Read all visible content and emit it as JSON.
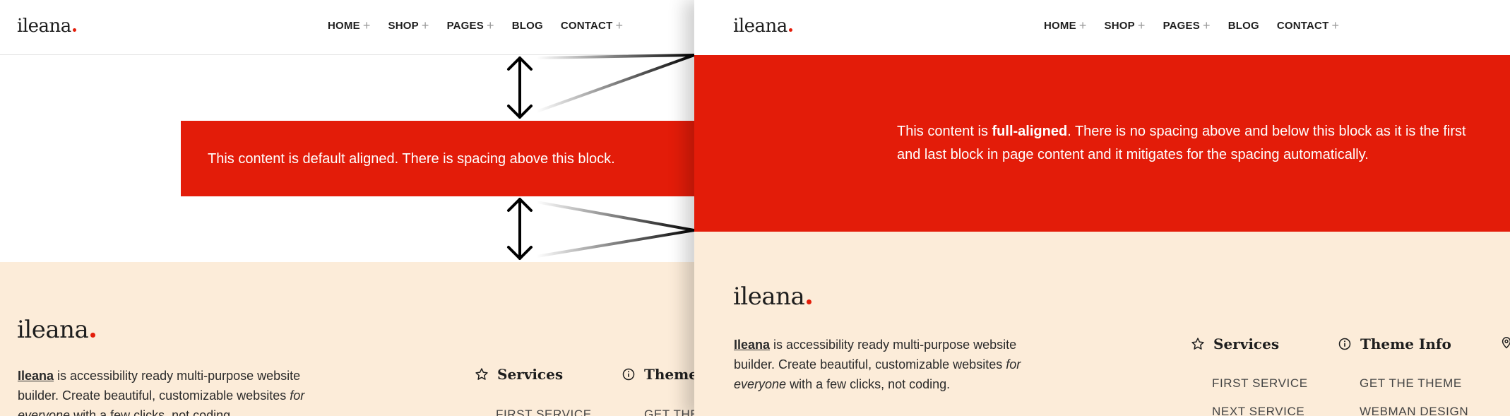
{
  "brand": {
    "name": "ileana",
    "accent_color": "#e31c09",
    "footer_bg": "#fcecd9"
  },
  "nav": [
    {
      "label": "HOME",
      "icon": "plus-icon",
      "has_submenu": true
    },
    {
      "label": "SHOP",
      "icon": "plus-icon",
      "has_submenu": true
    },
    {
      "label": "PAGES",
      "icon": "plus-icon",
      "has_submenu": true
    },
    {
      "label": "BLOG",
      "has_submenu": false
    },
    {
      "label": "CONTACT",
      "icon": "plus-icon",
      "has_submenu": true
    }
  ],
  "left": {
    "block_text": "This content is default aligned. There is spacing above this block."
  },
  "right": {
    "block_prefix": "This content is ",
    "block_bold": "full-aligned",
    "block_rest": ". There is no spacing above and below this block as it is the first and last block in page content and it mitigates for the spacing automatically."
  },
  "footer": {
    "desc_link": "Ileana",
    "desc_main": " is accessibility ready multi-purpose website builder. Create beautiful, customizable websites ",
    "desc_italic": "for everyone",
    "desc_tail": " with a few clicks, not coding.",
    "left_desc_line1_rest": " is accessibility ready multi-purpose website",
    "left_desc_line2": "builder. Create beautiful, customizable websites ",
    "left_desc_line2_italic": "for",
    "left_desc_line3_italic": "everyone",
    "left_desc_line3_rest": " with a few clicks, not coding.",
    "columns": [
      {
        "title": "Services",
        "icon": "star-icon",
        "links": [
          "FIRST SERVICE",
          "NEXT SERVICE"
        ]
      },
      {
        "title": "Theme Info",
        "icon": "info-icon",
        "links": [
          "GET THE THEME",
          "WEBMAN DESIGN"
        ]
      },
      {
        "title": "",
        "icon": "location-pin-icon",
        "links": []
      }
    ],
    "left_col_truncated": "Theme",
    "left_link_truncated_1": "FIRST SERVICE",
    "left_link_truncated_2": "GET THE"
  },
  "annotations": {
    "arrow_icon": "double-arrow-icon"
  }
}
